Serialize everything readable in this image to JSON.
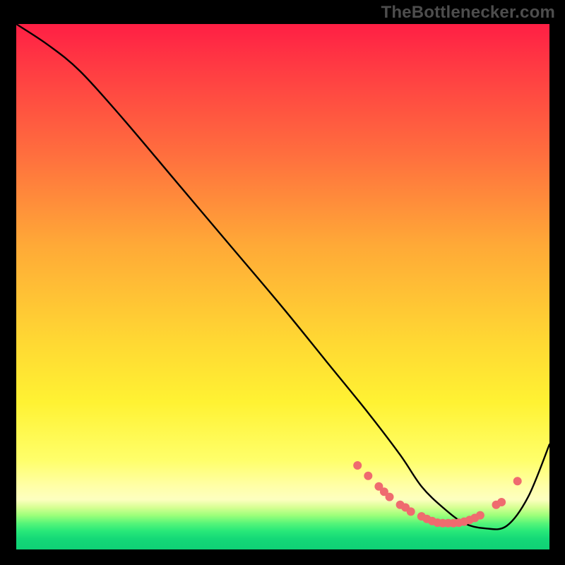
{
  "watermark": "TheBottlenecker.com",
  "chart_data": {
    "type": "line",
    "title": "",
    "xlabel": "",
    "ylabel": "",
    "xlim": [
      0,
      100
    ],
    "ylim": [
      0,
      100
    ],
    "grid": false,
    "legend": false,
    "series": [
      {
        "name": "bottleneck-curve",
        "color": "#000000",
        "x": [
          0,
          6,
          12,
          20,
          30,
          40,
          50,
          58,
          66,
          72,
          76,
          80,
          84,
          88,
          92,
          96,
          100
        ],
        "y": [
          100,
          96,
          91,
          82,
          70,
          58,
          46,
          36,
          26,
          18,
          12,
          8,
          5,
          4,
          4.5,
          10,
          20
        ]
      }
    ],
    "markers": {
      "name": "highlight-points",
      "color": "#ef6b6f",
      "x": [
        64,
        66,
        68,
        69,
        70,
        72,
        73,
        74,
        76,
        77,
        78,
        79,
        80,
        81,
        82,
        83,
        84,
        85,
        86,
        87,
        90,
        91,
        94
      ],
      "y": [
        16,
        14,
        12,
        11,
        10,
        8.5,
        8,
        7.2,
        6.3,
        5.8,
        5.4,
        5.1,
        5.0,
        5.0,
        5.0,
        5.1,
        5.3,
        5.6,
        6.0,
        6.5,
        8.5,
        9,
        13
      ]
    },
    "gradient_stops": [
      {
        "pos": 0.0,
        "color": "#ff1f44"
      },
      {
        "pos": 0.25,
        "color": "#ff6f3e"
      },
      {
        "pos": 0.42,
        "color": "#ffa937"
      },
      {
        "pos": 0.6,
        "color": "#ffd733"
      },
      {
        "pos": 0.83,
        "color": "#ffff6a"
      },
      {
        "pos": 0.92,
        "color": "#d7ff93"
      },
      {
        "pos": 1.0,
        "color": "#0fd176"
      }
    ]
  }
}
